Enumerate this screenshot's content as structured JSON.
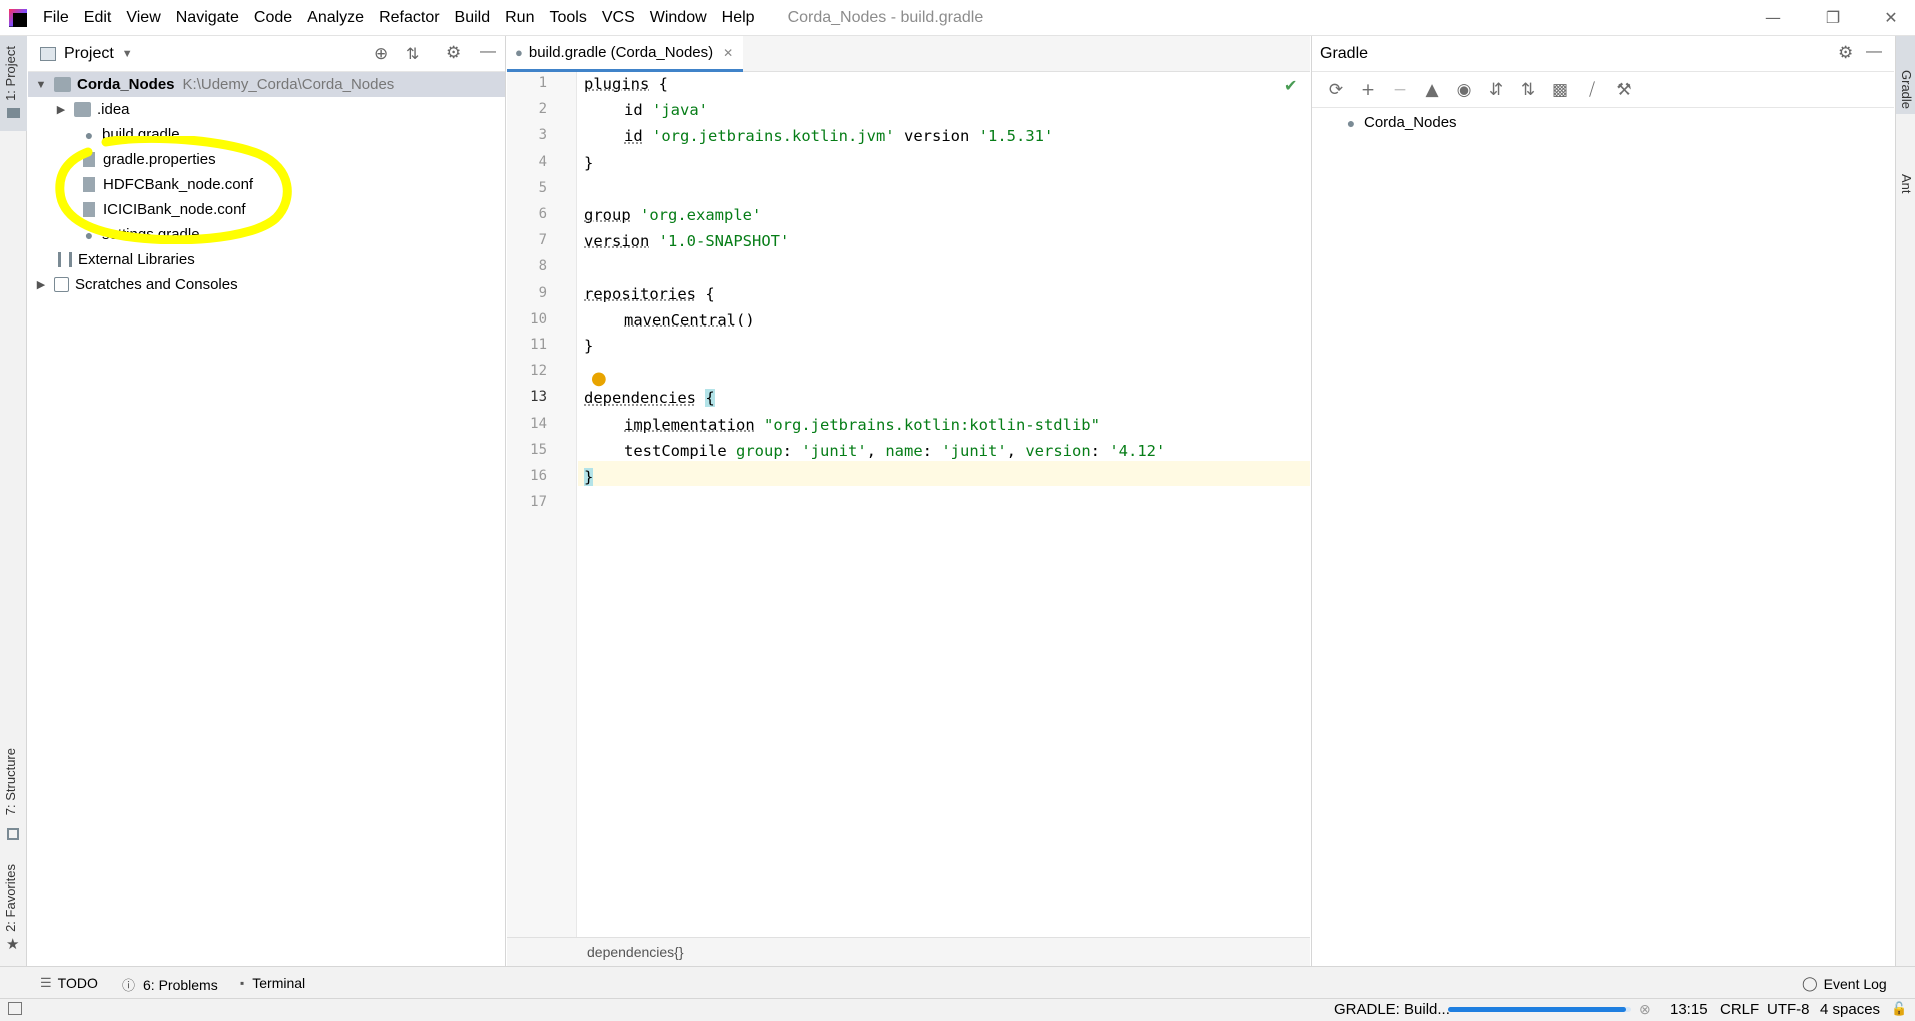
{
  "menubar": {
    "items": [
      "File",
      "Edit",
      "View",
      "Navigate",
      "Code",
      "Analyze",
      "Refactor",
      "Build",
      "Run",
      "Tools",
      "VCS",
      "Window",
      "Help"
    ],
    "title": "Corda_Nodes - build.gradle"
  },
  "left_stripe": {
    "project_tab": "1: Project",
    "structure_tab": "7: Structure",
    "favorites_tab": "2: Favorites"
  },
  "project_panel": {
    "title": "Project",
    "root": {
      "name": "Corda_Nodes",
      "path": "K:\\Udemy_Corda\\Corda_Nodes"
    },
    "items": [
      ".idea",
      "build.gradle",
      "gradle.properties",
      "HDFCBank_node.conf",
      "ICICIBank_node.conf",
      "settings.gradle"
    ],
    "external_libraries": "External Libraries",
    "scratches": "Scratches and Consoles"
  },
  "editor": {
    "tab_label": "build.gradle (Corda_Nodes)",
    "line_numbers": [
      "1",
      "2",
      "3",
      "4",
      "5",
      "6",
      "7",
      "8",
      "9",
      "10",
      "11",
      "12",
      "13",
      "14",
      "15",
      "16",
      "17"
    ],
    "lines": [
      {
        "kw": "plugins",
        "rest": " {"
      },
      {
        "kw": "id",
        "str": "'java'"
      },
      {
        "kw": "id",
        "str": "'org.jetbrains.kotlin.jvm'",
        "mid": " version ",
        "str2": "'1.5.31'"
      },
      {
        "rest": "}"
      },
      {
        "rest": ""
      },
      {
        "kw": "group",
        "str": "'org.example'"
      },
      {
        "kw": "version",
        "str": "'1.0-SNAPSHOT'"
      },
      {
        "rest": ""
      },
      {
        "kw": "repositories",
        "rest": " {"
      },
      {
        "kw": "mavenCentral",
        "rest": "()"
      },
      {
        "rest": "}"
      },
      {
        "rest": ""
      },
      {
        "kw": "dependencies",
        "rest": " {"
      },
      {
        "kw": "implementation",
        "str": "\"org.jetbrains.kotlin:kotlin-stdlib\""
      },
      {
        "kw": "testCompile",
        "p1": "group",
        "s1": "'junit'",
        "p2": "name",
        "s2": "'junit'",
        "p3": "version",
        "s3": "'4.12'"
      },
      {
        "rest": "}"
      },
      {
        "rest": ""
      }
    ],
    "breadcrumb": "dependencies{}"
  },
  "gradle_panel": {
    "title": "Gradle",
    "project": "Corda_Nodes"
  },
  "right_stripe": {
    "gradle_tab": "Gradle",
    "ant_tab": "Ant"
  },
  "bottom_toolbar": {
    "todo": "TODO",
    "problems": "6: Problems",
    "terminal": "Terminal",
    "event_log": "Event Log"
  },
  "status_bar": {
    "task": "GRADLE: Build...",
    "progress": 0.97,
    "position": "13:15",
    "line_sep": "CRLF",
    "encoding": "UTF-8",
    "indent": "4 spaces"
  },
  "colors": {
    "accent": "#4083c9",
    "string": "#067d17",
    "annotation": "#ffff00"
  }
}
